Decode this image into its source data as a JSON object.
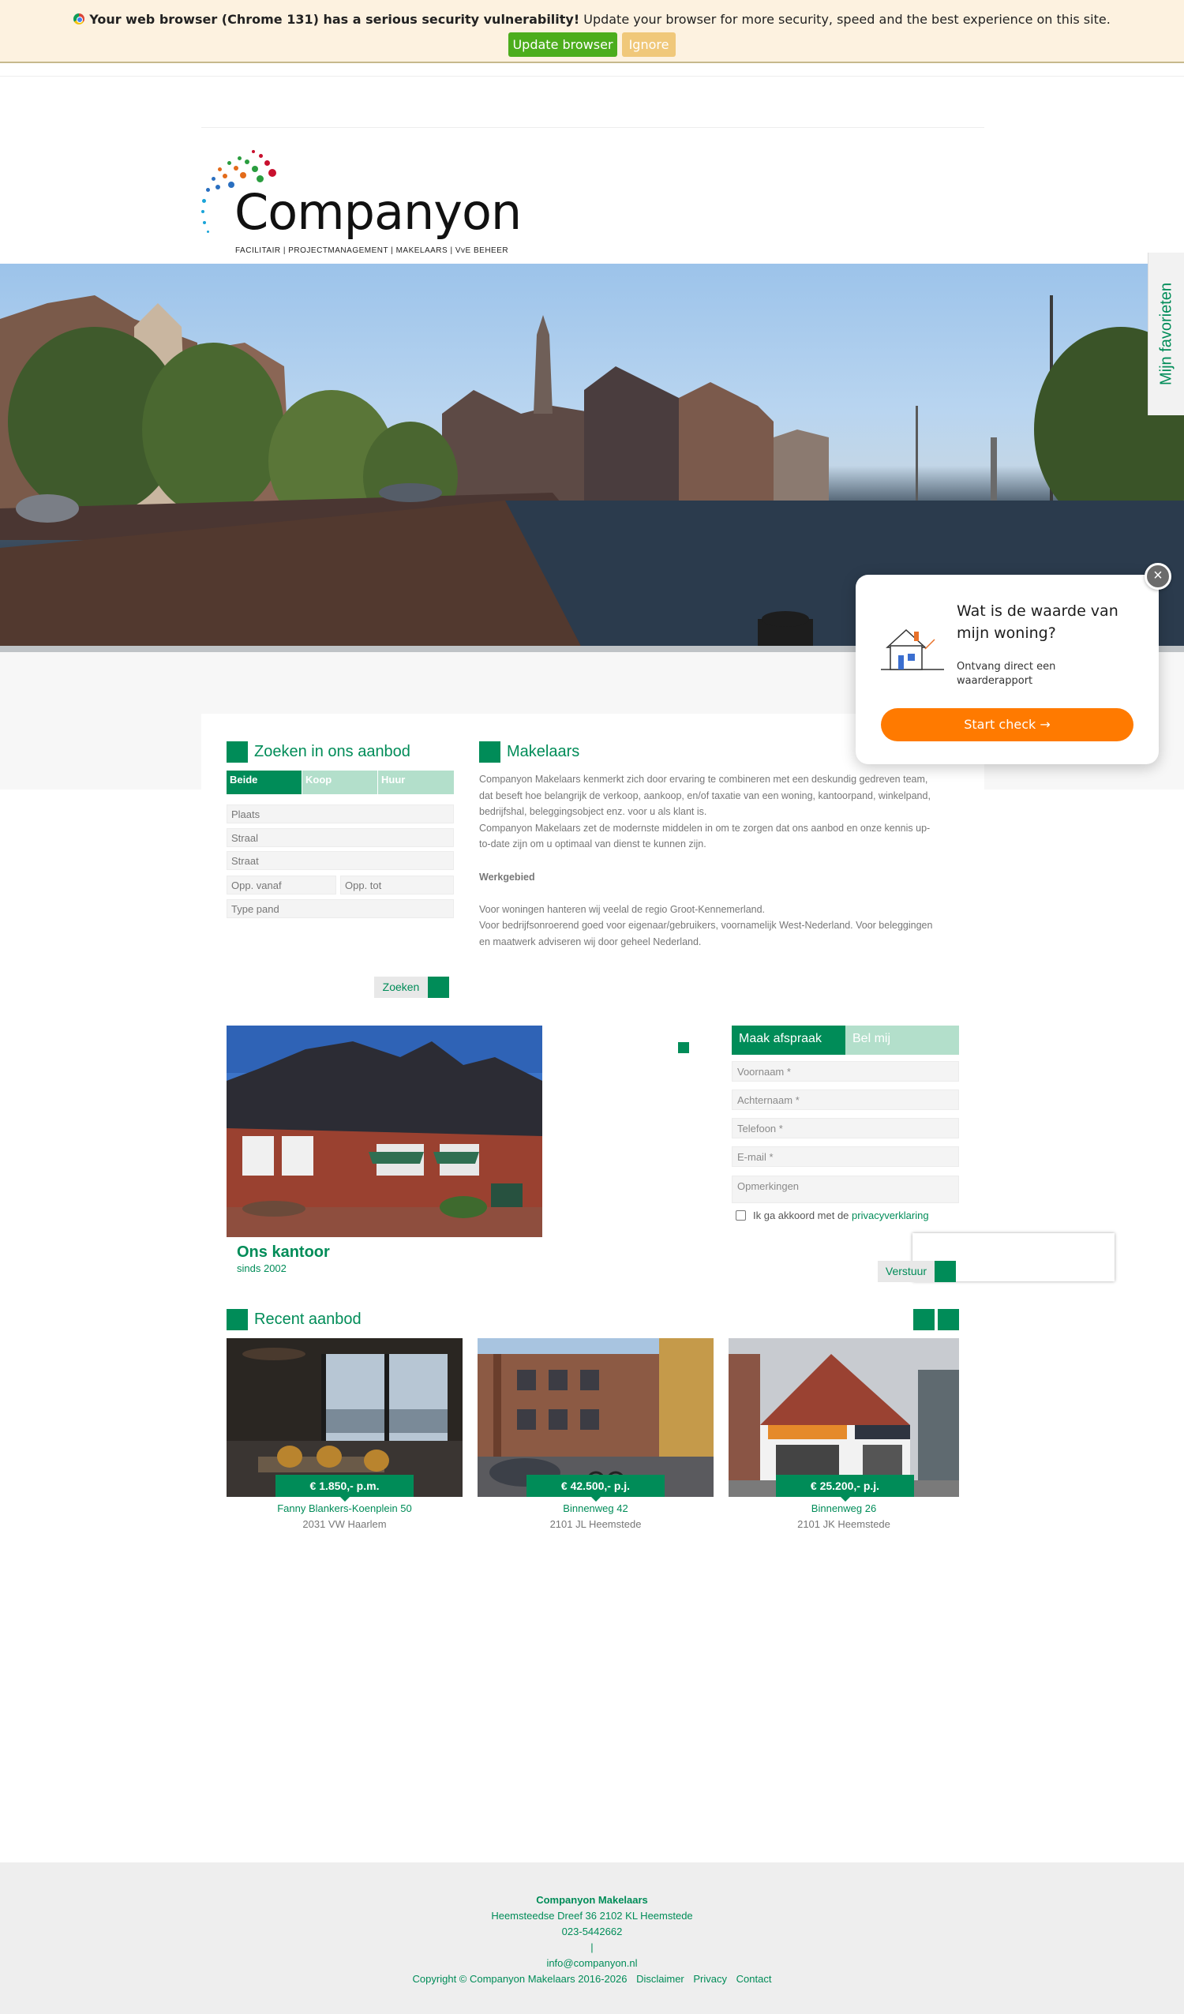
{
  "update_bar": {
    "warning_bold": "Your web browser (Chrome 131) has a serious security vulnerability!",
    "warning_rest": " Update your browser for more security, speed and the best experience on this site.",
    "update_button": "Update browser",
    "ignore_button": "Ignore"
  },
  "logo": {
    "name": "Companyon",
    "tagline": "FACILITAIR  |  PROJECTMANAGEMENT  |  MAKELAARS  |  VvE BEHEER"
  },
  "favorites_tab": "Mijn favorieten",
  "search": {
    "title": "Zoeken in ons aanbod",
    "tabs": [
      "Beide",
      "Koop",
      "Huur"
    ],
    "fields": {
      "plaats": "Plaats",
      "straat1": "Straal",
      "straat2": "Straat",
      "opp_vanaf": "Opp. vanaf",
      "opp_tot": "Opp. tot",
      "type_pand": "Type pand"
    },
    "button": "Zoeken"
  },
  "makelaars": {
    "title": "Makelaars",
    "lines": [
      "Companyon Makelaars kenmerkt zich door ervaring te combineren met een deskundig gedreven team,",
      "dat beseft hoe belangrijk de verkoop, aankoop, en/of taxatie van een woning, kantoorpand, winkelpand,",
      "bedrijfshal, beleggingsobject enz. voor u als klant is.",
      "Companyon Makelaars zet de modernste middelen in om te zorgen dat ons aanbod en onze kennis up-",
      "to-date zijn om u optimaal van dienst te kunnen zijn."
    ],
    "werkgebied_title": "Werkgebied",
    "werkgebied_lines": [
      "Voor woningen hanteren wij veelal de regio Groot-Kennemerland.",
      "Voor bedrijfsonroerend goed voor eigenaar/gebruikers, voornamelijk West-Nederland. Voor beleggingen",
      "en maatwerk adviseren wij door geheel Nederland."
    ]
  },
  "office": {
    "title": "Ons kantoor",
    "subtitle": "sinds 2002"
  },
  "contact": {
    "tabs": [
      "Maak afspraak",
      "Bel mij"
    ],
    "fields": {
      "voornaam": "Voornaam *",
      "achternaam": "Achternaam *",
      "telefoon": "Telefoon *",
      "email": "E-mail *",
      "opmerkingen": "Opmerkingen"
    },
    "privacy_text": "Ik ga akkoord met de ",
    "privacy_link": "privacyverklaring",
    "submit": "Verstuur"
  },
  "recent": {
    "title": "Recent aanbod",
    "listings": [
      {
        "price": "€ 1.850,- p.m.",
        "street": "Fanny Blankers-Koenplein 50",
        "city": "2031 VW Haarlem"
      },
      {
        "price": "€ 42.500,- p.j.",
        "street": "Binnenweg 42",
        "city": "2101 JL Heemstede"
      },
      {
        "price": "€ 25.200,- p.j.",
        "street": "Binnenweg 26",
        "city": "2101 JK Heemstede"
      }
    ]
  },
  "popup": {
    "question": "Wat is de waarde van mijn woning?",
    "description": "Ontvang direct een waarderapport",
    "button": "Start check",
    "close": "×"
  },
  "footer": {
    "company": "Companyon Makelaars",
    "address": "Heemsteedse Dreef 36   2102 KL Heemstede",
    "phone": "023-5442662",
    "separator": "|",
    "email": "info@companyon.nl",
    "copyright": "Copyright © Companyon Makelaars 2016-2026",
    "links": [
      "Disclaimer",
      "Privacy",
      "Contact"
    ]
  },
  "colors": {
    "brand_green": "#008c58",
    "light_green": "#b3dfcb",
    "orange": "#ff7a00",
    "update_green": "#4cad1c",
    "ignore_orange": "#f0c87a"
  }
}
